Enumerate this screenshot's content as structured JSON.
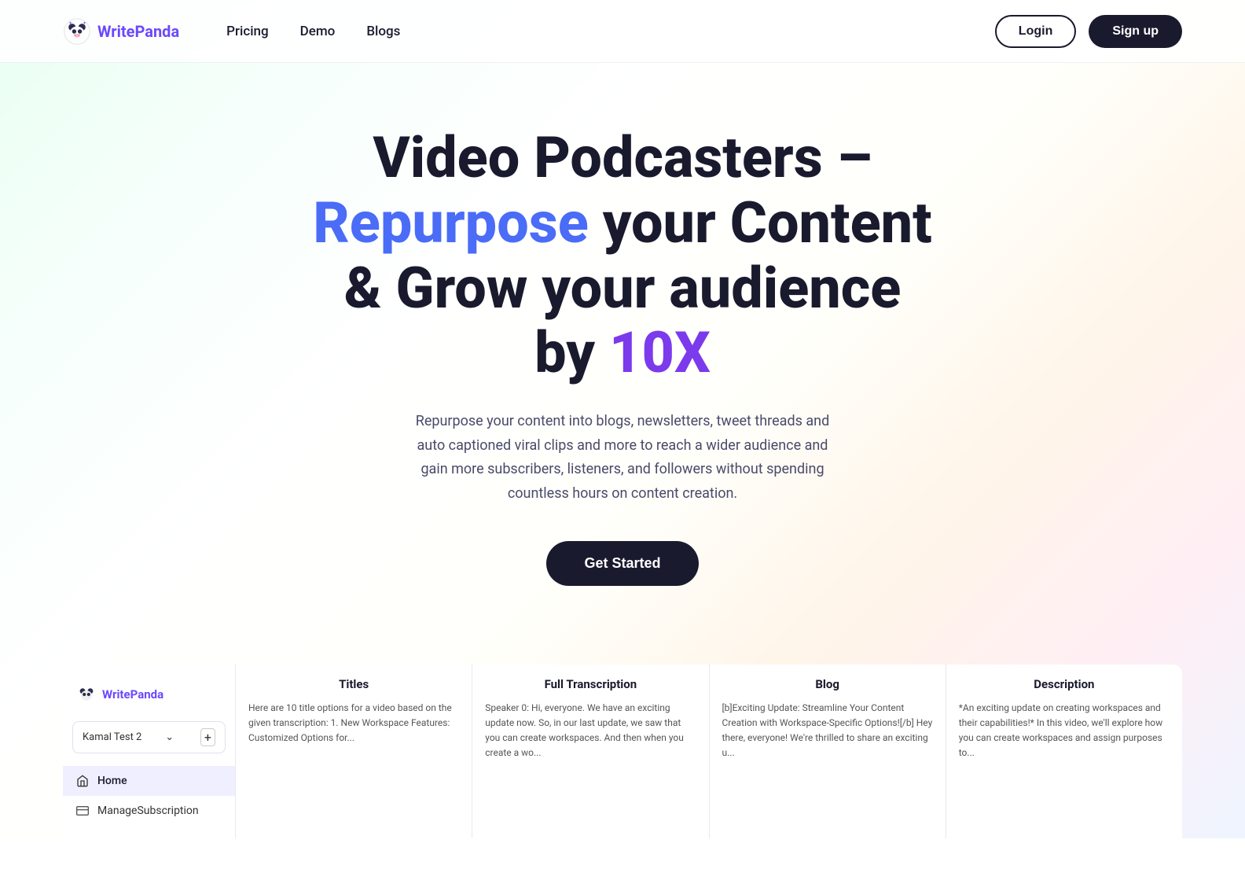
{
  "brand": {
    "name": "WritePanda",
    "name_prefix": "Write",
    "name_suffix": "Panda"
  },
  "navbar": {
    "links": [
      {
        "id": "pricing",
        "label": "Pricing"
      },
      {
        "id": "demo",
        "label": "Demo"
      },
      {
        "id": "blogs",
        "label": "Blogs"
      }
    ],
    "login_label": "Login",
    "signup_label": "Sign up"
  },
  "hero": {
    "title_line1": "Video Podcasters –",
    "title_line2_normal": " your Content",
    "title_line2_highlight": "Repurpose",
    "title_line3": "& Grow your audience",
    "title_line4_normal": "by ",
    "title_line4_highlight": "10X",
    "subtitle": "Repurpose your content into blogs, newsletters, tweet threads and auto captioned viral clips and more to reach a wider audience and gain more subscribers, listeners, and followers without spending countless hours on content creation.",
    "cta_label": "Get Started"
  },
  "sidebar": {
    "workspace_name": "Kamal Test 2",
    "nav_items": [
      {
        "id": "home",
        "label": "Home",
        "icon": "home"
      },
      {
        "id": "manage-subscription",
        "label": "ManageSubscription",
        "icon": "credit-card"
      }
    ]
  },
  "preview_columns": [
    {
      "id": "titles",
      "header": "Titles",
      "text": "Here are 10 title options for a video based on the given transcription:\n\n1. New Workspace Features: Customized Options for..."
    },
    {
      "id": "full-transcription",
      "header": "Full Transcription",
      "text": "Speaker 0: Hi, everyone. We have an exciting update now. So, in our last update, we saw that you can create workspaces. And then when you create a wo..."
    },
    {
      "id": "blog",
      "header": "Blog",
      "text": "[b]Exciting Update: Streamline Your Content Creation with Workspace-Specific Options![/b]\n\nHey there, everyone! We're thrilled to share an exciting u..."
    },
    {
      "id": "description",
      "header": "Description",
      "text": "*An exciting update on creating workspaces and their capabilities!* In this video, we'll explore how you can create workspaces and assign purposes to..."
    }
  ]
}
